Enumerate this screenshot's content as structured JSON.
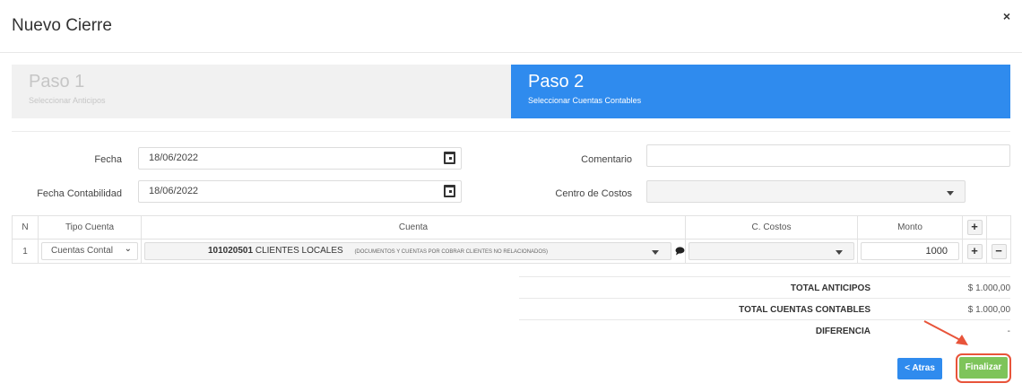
{
  "modal": {
    "title": "Nuevo Cierre",
    "close_label": "×"
  },
  "steps": [
    {
      "title": "Paso 1",
      "subtitle": "Seleccionar Anticipos",
      "active": false
    },
    {
      "title": "Paso 2",
      "subtitle": "Seleccionar Cuentas Contables",
      "active": true
    }
  ],
  "form": {
    "fecha_label": "Fecha",
    "fecha_value": "18/06/2022",
    "fecha_contable_label": "Fecha Contabilidad",
    "fecha_contable_value": "18/06/2022",
    "comentario_label": "Comentario",
    "comentario_value": "",
    "centro_label": "Centro de Costos",
    "centro_value": ""
  },
  "table": {
    "headers": {
      "n": "N",
      "tipo": "Tipo Cuenta",
      "cuenta": "Cuenta",
      "ccostos": "C. Costos",
      "monto": "Monto",
      "add": "+"
    },
    "rows": [
      {
        "n": "1",
        "tipo": "Cuentas Contal",
        "cuenta_code": "101020501",
        "cuenta_name": "CLIENTES LOCALES",
        "cuenta_desc": "(DOCUMENTOS Y CUENTAS POR COBRAR CLIENTES NO RELACIONADOS)",
        "ccostos": "",
        "monto": "1000",
        "add": "+",
        "remove": "−"
      }
    ]
  },
  "totals": {
    "anticipos_label": "TOTAL ANTICIPOS",
    "anticipos_value": "$ 1.000,00",
    "cuentas_label": "TOTAL CUENTAS CONTABLES",
    "cuentas_value": "$ 1.000,00",
    "diferencia_label": "DIFERENCIA",
    "diferencia_value": "-"
  },
  "buttons": {
    "back": "< Atras",
    "finish": "Finalizar"
  },
  "colors": {
    "primary": "#2f8bee",
    "success": "#7ec45a",
    "highlight": "#e8543a"
  },
  "icons": {
    "calendar": "calendar-icon",
    "comment": "comment-icon",
    "close": "close-icon"
  }
}
